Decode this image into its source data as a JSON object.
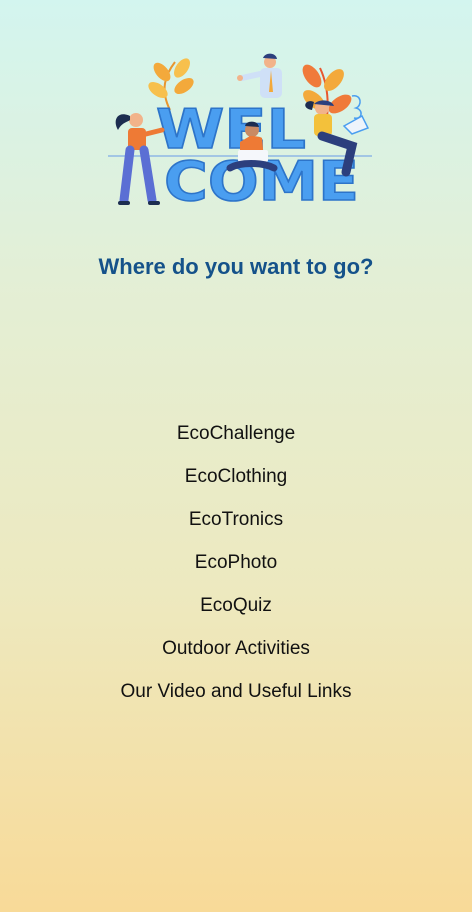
{
  "hero": {
    "word_line1": "WEL",
    "word_line2": "COME"
  },
  "question": "Where do you want to go?",
  "menu": [
    {
      "label": "EcoChallenge"
    },
    {
      "label": "EcoClothing"
    },
    {
      "label": "EcoTronics"
    },
    {
      "label": "EcoPhoto"
    },
    {
      "label": "EcoQuiz"
    },
    {
      "label": "Outdoor Activities"
    },
    {
      "label": "Our Video and Useful Links"
    }
  ],
  "colors": {
    "title": "#15528a",
    "letters": "#4a9ef0",
    "leaf": "#f3a93b",
    "figure_orange": "#ee7a35",
    "figure_navy": "#2c3f7d"
  }
}
